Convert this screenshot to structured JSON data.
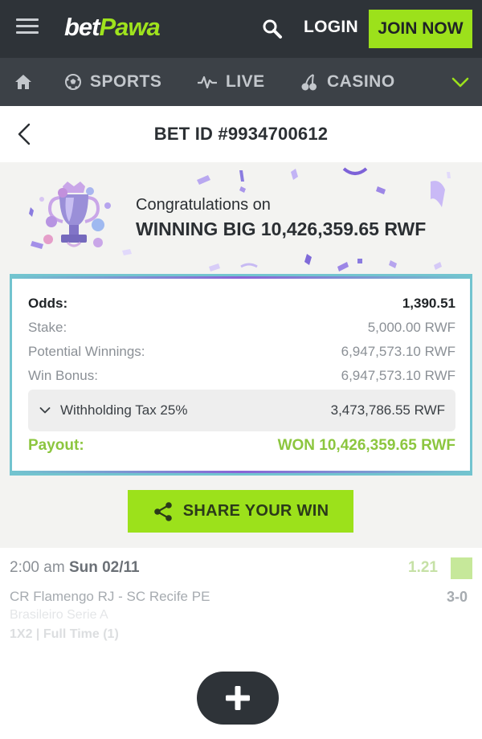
{
  "header": {
    "logo_bet": "bet",
    "logo_pawa": "Pawa",
    "login_label": "LOGIN",
    "join_label": "JOIN NOW"
  },
  "nav": {
    "items": [
      {
        "label": "SPORTS",
        "icon": "soccer-ball-icon"
      },
      {
        "label": "LIVE",
        "icon": "pulse-icon"
      },
      {
        "label": "CASINO",
        "icon": "cherries-icon"
      }
    ]
  },
  "bet": {
    "title": "BET ID #9934700612",
    "congrats_line1": "Congratulations on",
    "congrats_line2": "WINNING BIG 10,426,359.65 RWF",
    "summary": {
      "odds_label": "Odds:",
      "odds_value": "1,390.51",
      "stake_label": "Stake:",
      "stake_value": "5,000.00 RWF",
      "potential_label": "Potential Winnings:",
      "potential_value": "6,947,573.10 RWF",
      "bonus_label": "Win Bonus:",
      "bonus_value": "6,947,573.10 RWF",
      "tax_label": "Withholding Tax 25%",
      "tax_value": "3,473,786.55 RWF",
      "payout_label": "Payout:",
      "payout_value": "WON 10,426,359.65 RWF"
    },
    "share_label": "SHARE YOUR WIN"
  },
  "selection": {
    "time": "2:00 am",
    "date": "Sun 02/11",
    "odds": "1.21",
    "match": "CR Flamengo RJ - SC Recife PE",
    "score": "3-0",
    "league": "Brasileiro Serie A",
    "market": "1X2 | Full Time (1)"
  },
  "colors": {
    "header_bg": "#2e3338",
    "nav_bg": "#3c4147",
    "accent_green": "#9ce11b",
    "payout_green": "#8cc63f",
    "card_border": "#72c4cf"
  }
}
